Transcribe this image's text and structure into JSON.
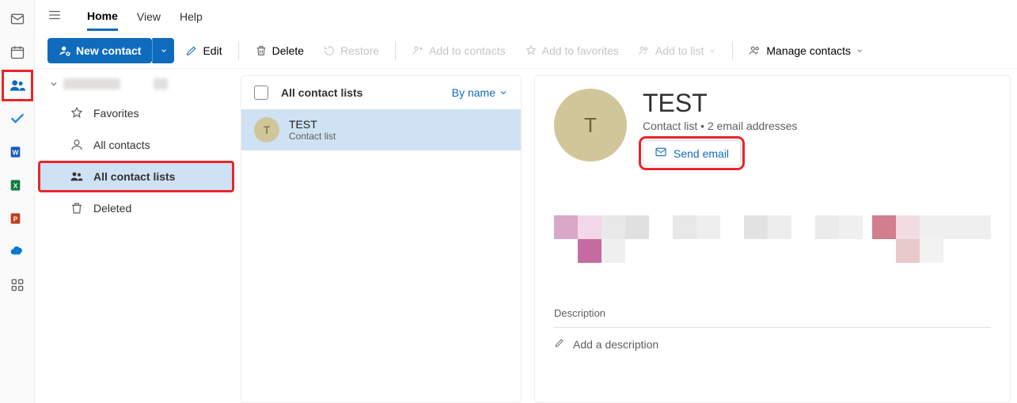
{
  "tabs": {
    "home": "Home",
    "view": "View",
    "help": "Help"
  },
  "toolbar": {
    "new_contact": "New contact",
    "edit": "Edit",
    "delete": "Delete",
    "restore": "Restore",
    "add_to_contacts": "Add to contacts",
    "add_to_favorites": "Add to favorites",
    "add_to_list": "Add to list",
    "manage_contacts": "Manage contacts"
  },
  "folders": {
    "favorites": "Favorites",
    "all_contacts": "All contacts",
    "all_contact_lists": "All contact lists",
    "deleted": "Deleted"
  },
  "list": {
    "header": "All contact lists",
    "sort_label": "By name",
    "items": [
      {
        "initial": "T",
        "name": "TEST",
        "subtitle": "Contact list"
      }
    ]
  },
  "detail": {
    "initial": "T",
    "title": "TEST",
    "type_label": "Contact list",
    "separator": " • ",
    "count_label": "2 email addresses",
    "send_email": "Send email",
    "description_label": "Description",
    "description_placeholder": "Add a description"
  },
  "rail": {
    "mail": "mail-icon",
    "calendar": "calendar-icon",
    "people": "people-icon",
    "todo": "todo-icon",
    "word": "word-icon",
    "excel": "excel-icon",
    "powerpoint": "powerpoint-icon",
    "onedrive": "onedrive-icon",
    "more": "more-apps-icon"
  },
  "pixel_colors_left": [
    "#d9a7c7",
    "#f4d7e8",
    "#e8e8e8",
    "#e0e0e0",
    "#ffffff",
    "#e8e8e8",
    "#eeeeee",
    "#ffffff",
    "#e2e2e2",
    "#ededed",
    "#ffffff",
    "#ebebeb",
    "#f0f0f0"
  ],
  "pixel_colors_left2": [
    "#ffffff",
    "#c76ca1",
    "#f0f0f0"
  ],
  "pixel_colors_right": [
    "#d27e8e",
    "#f1dde1",
    "#efefef",
    "#efefef",
    "#efefef"
  ],
  "pixel_colors_right2": [
    "#ffffff",
    "#e8caca",
    "#f2f2f2"
  ]
}
